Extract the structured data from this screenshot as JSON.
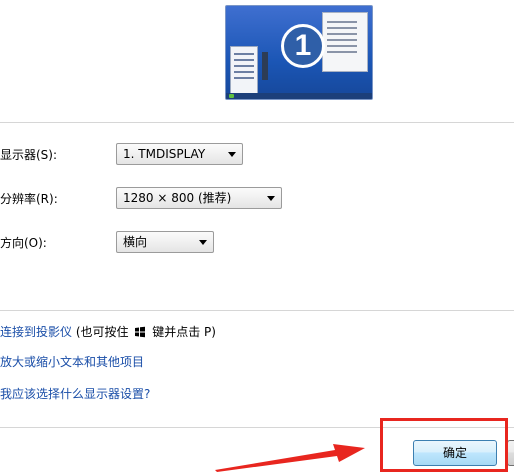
{
  "monitor": {
    "number": "1"
  },
  "settings": {
    "display_label": "显示器(S):",
    "display_value": "1. TMDISPLAY",
    "resolution_label": "分辨率(R):",
    "resolution_value": "1280 × 800 (推荐)",
    "orientation_label": "方向(O):",
    "orientation_value": "横向"
  },
  "links": {
    "projector": "连接到投影仪",
    "projector_suffix_before": "(也可按住",
    "projector_suffix_after": "键并点击 P)",
    "text_size": "放大或缩小文本和其他项目",
    "which_settings": "我应该选择什么显示器设置?"
  },
  "buttons": {
    "ok": "确定"
  },
  "colors": {
    "link": "#1a4ea8",
    "annotation": "#e8261f"
  },
  "icons": [
    "windows-logo-icon",
    "dropdown-arrow-icon"
  ]
}
